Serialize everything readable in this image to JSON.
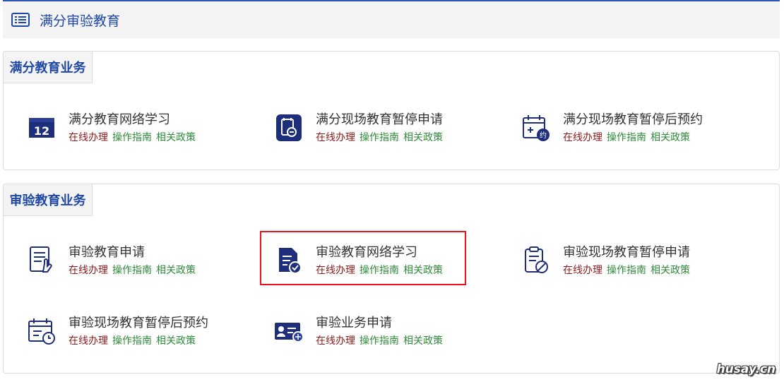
{
  "header": {
    "title": "满分审验教育",
    "icon": "list-icon"
  },
  "links": {
    "online": "在线办理",
    "guide": "操作指南",
    "policy": "相关政策"
  },
  "sections": [
    {
      "title": "满分教育业务",
      "items": [
        {
          "name": "满分教育网络学习",
          "icon": "calendar-12-icon"
        },
        {
          "name": "满分现场教育暂停申请",
          "icon": "pause-document-icon"
        },
        {
          "name": "满分现场教育暂停后预约",
          "icon": "calendar-appointment-icon"
        }
      ]
    },
    {
      "title": "审验教育业务",
      "items": [
        {
          "name": "审验教育申请",
          "icon": "document-hand-icon"
        },
        {
          "name": "审验教育网络学习",
          "icon": "document-check-icon"
        },
        {
          "name": "审验现场教育暂停申请",
          "icon": "clipboard-ban-icon"
        },
        {
          "name": "审验现场教育暂停后预约",
          "icon": "calendar-clock-icon"
        },
        {
          "name": "审验业务申请",
          "icon": "id-card-icon"
        }
      ]
    }
  ],
  "watermark": "husay.cn",
  "colors": {
    "brand": "#1f47a8",
    "online": "#8b1a1a",
    "guide": "#2e8b3a",
    "highlight": "#e8161b"
  }
}
